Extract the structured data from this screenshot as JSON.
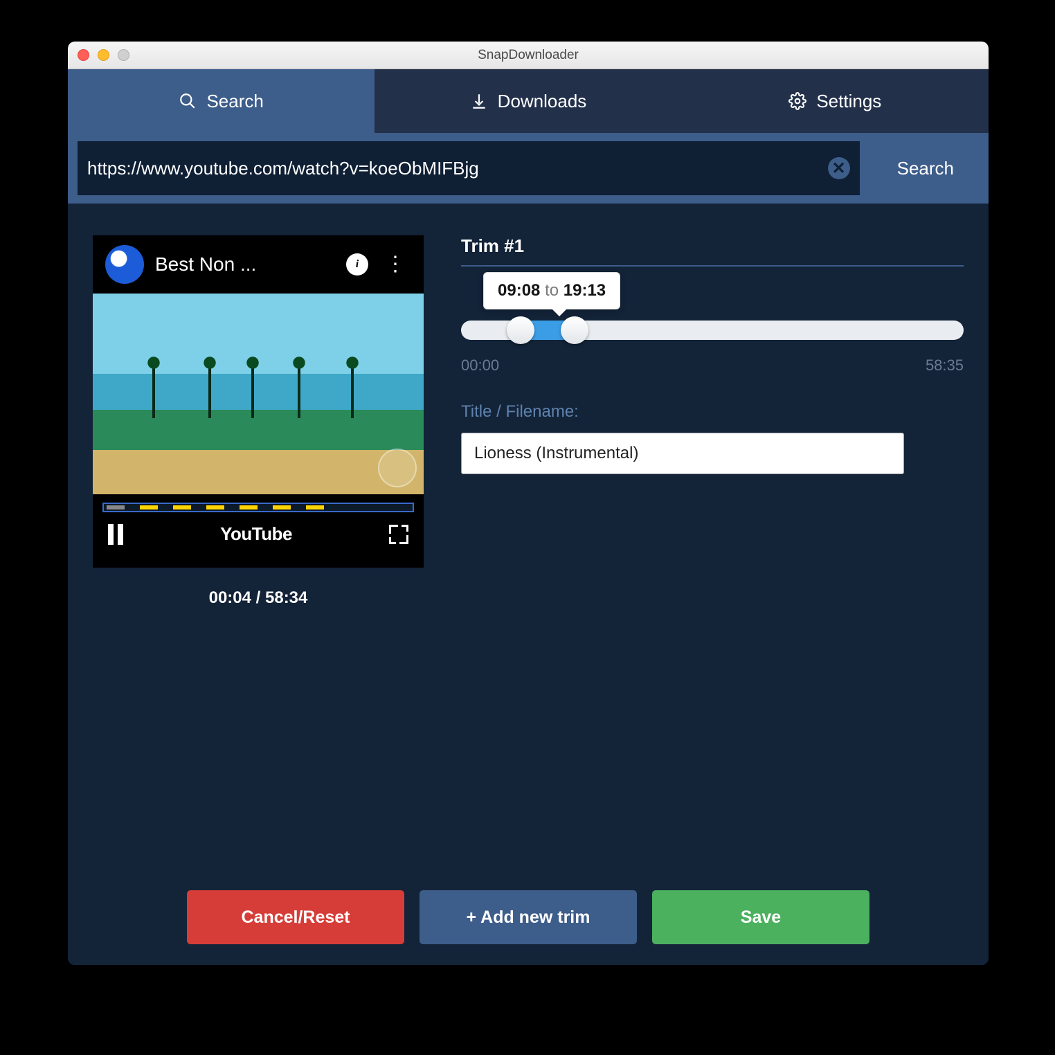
{
  "window": {
    "title": "SnapDownloader"
  },
  "tabs": {
    "search": "Search",
    "downloads": "Downloads",
    "settings": "Settings"
  },
  "search": {
    "url": "https://www.youtube.com/watch?v=koeObMIFBjg",
    "button": "Search"
  },
  "preview": {
    "title": "Best Non ...",
    "brand": "YouTube",
    "time_display": "00:04 / 58:34"
  },
  "trim": {
    "heading": "Trim #1",
    "tooltip_from": "09:08",
    "tooltip_to_word": "to",
    "tooltip_to": "19:13",
    "range_min": "00:00",
    "range_max": "58:35",
    "filename_label": "Title / Filename:",
    "filename_value": "Lioness (Instrumental)"
  },
  "footer": {
    "cancel": "Cancel/Reset",
    "add": "+ Add new trim",
    "save": "Save"
  }
}
